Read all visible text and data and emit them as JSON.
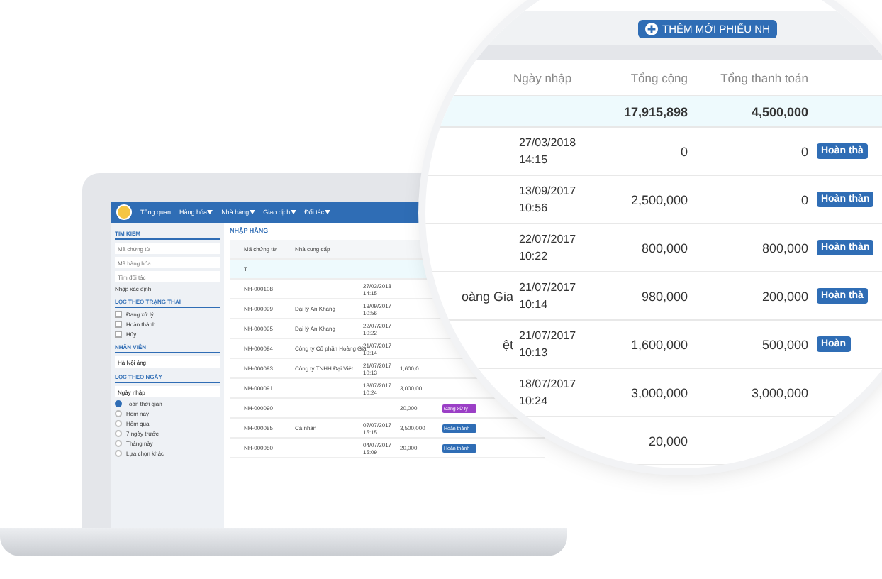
{
  "nav": {
    "items": [
      {
        "label": "Tổng quan",
        "dropdown": false
      },
      {
        "label": "Hàng hóa",
        "dropdown": true
      },
      {
        "label": "Nhà hàng",
        "dropdown": true
      },
      {
        "label": "Giao dịch",
        "dropdown": true
      },
      {
        "label": "Đối tác",
        "dropdown": true
      }
    ]
  },
  "sidebar": {
    "search": {
      "title": "TÌM KIẾM",
      "fields": [
        {
          "placeholder": "Mã chứng từ"
        },
        {
          "placeholder": "Mã hàng hóa"
        },
        {
          "placeholder": "Tìm đối tác"
        }
      ],
      "link": "Nhập xác định"
    },
    "status_filter": {
      "title": "LỌC THEO TRẠNG THÁI",
      "options": [
        {
          "label": "Đang xử lý",
          "checked": false
        },
        {
          "label": "Hoàn thành",
          "checked": false
        },
        {
          "label": "Hủy",
          "checked": false
        }
      ]
    },
    "staff": {
      "title": "NHÂN VIÊN",
      "value": "Hà Nội ảng"
    },
    "date_filter": {
      "title": "LỌC THEO NGÀY",
      "select": "Ngày nhập",
      "options": [
        {
          "label": "Toàn thời gian",
          "selected": true
        },
        {
          "label": "Hôm nay",
          "selected": false
        },
        {
          "label": "Hôm qua",
          "selected": false
        },
        {
          "label": "7 ngày trước",
          "selected": false
        },
        {
          "label": "Tháng này",
          "selected": false
        },
        {
          "label": "Lựa chọn khác",
          "selected": false
        }
      ]
    }
  },
  "main": {
    "title": "NHẬP HÀNG",
    "columns": [
      "Mã chứng từ",
      "Nhà cung cấp"
    ],
    "summary": "T",
    "rows": [
      {
        "code": "NH-000108",
        "supplier": "",
        "date": "27/03/2018",
        "time": "14:15",
        "total": "",
        "status": null
      },
      {
        "code": "NH-000099",
        "supplier": "Đại lý An Khang",
        "date": "13/09/2017",
        "time": "10:56",
        "total": "",
        "status": null
      },
      {
        "code": "NH-000095",
        "supplier": "Đại lý An Khang",
        "date": "22/07/2017",
        "time": "10:22",
        "total": "",
        "status": null
      },
      {
        "code": "NH-000094",
        "supplier": "Công ty Cổ phần Hoàng Gia",
        "date": "21/07/2017",
        "time": "10:14",
        "total": "",
        "status": null
      },
      {
        "code": "NH-000093",
        "supplier": "Công ty TNHH Đại Việt",
        "date": "21/07/2017",
        "time": "10:13",
        "total": "1,600,0",
        "status": null
      },
      {
        "code": "NH-000091",
        "supplier": "",
        "date": "18/07/2017",
        "time": "10:24",
        "total": "3,000,00",
        "status": null
      },
      {
        "code": "NH-000090",
        "supplier": "",
        "date": "",
        "time": "",
        "total": "20,000",
        "status": {
          "kind": "pending",
          "label": "Đang xử lý"
        }
      },
      {
        "code": "NH-000085",
        "supplier": "Cá nhân",
        "date": "07/07/2017",
        "time": "15:15",
        "total": "3,500,000",
        "status": {
          "kind": "done",
          "label": "Hoàn thành"
        }
      },
      {
        "code": "NH-000080",
        "supplier": "",
        "date": "04/07/2017",
        "time": "15:09",
        "total": "20,000",
        "status": {
          "kind": "done",
          "label": "Hoàn thành"
        }
      }
    ]
  },
  "magnifier": {
    "add_button": "THÊM MỚI PHIẾU NH",
    "columns": [
      "Ngày nhập",
      "Tổng cộng",
      "Tổng thanh toán"
    ],
    "summary": {
      "total": "17,915,898",
      "paid": "4,500,000"
    },
    "rows": [
      {
        "supplier": "",
        "date": "27/03/2018",
        "time": "14:15",
        "total": "0",
        "paid": "0",
        "status": {
          "kind": "done",
          "label": "Hoàn thà"
        }
      },
      {
        "supplier": "",
        "date": "13/09/2017",
        "time": "10:56",
        "total": "2,500,000",
        "paid": "0",
        "status": {
          "kind": "done",
          "label": "Hoàn thàn"
        }
      },
      {
        "supplier": "",
        "date": "22/07/2017",
        "time": "10:22",
        "total": "800,000",
        "paid": "800,000",
        "status": {
          "kind": "done",
          "label": "Hoàn thàn"
        }
      },
      {
        "supplier": "oàng Gia",
        "date": "21/07/2017",
        "time": "10:14",
        "total": "980,000",
        "paid": "200,000",
        "status": {
          "kind": "done",
          "label": "Hoàn thà"
        }
      },
      {
        "supplier": "ệt",
        "date": "21/07/2017",
        "time": "10:13",
        "total": "1,600,000",
        "paid": "500,000",
        "status": {
          "kind": "done",
          "label": "Hoàn"
        }
      },
      {
        "supplier": "",
        "date": "18/07/2017",
        "time": "10:24",
        "total": "3,000,000",
        "paid": "3,000,000",
        "status": null
      },
      {
        "supplier": "",
        "date": "",
        "time": "",
        "total": "20,000",
        "paid": "",
        "status": null
      }
    ]
  }
}
